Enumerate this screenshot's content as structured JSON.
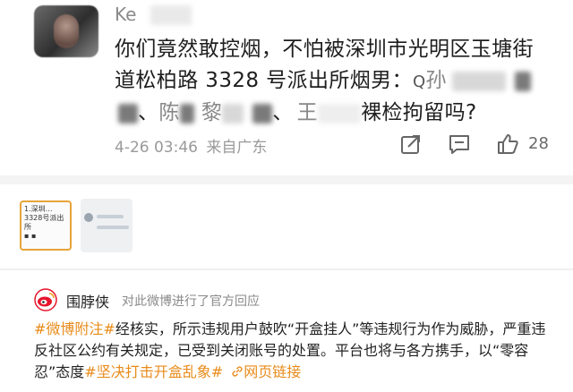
{
  "comment": {
    "username_visible": "Ke",
    "text_line1": "你们竟然敢控烟，不怕被深圳市光明区玉塘街",
    "text_line2": "道松柏路 3328 号派出所烟男：",
    "search_glyph": "Q",
    "name_fragment_1": "孙",
    "name_fragment_2": "、",
    "name_fragment_3": "陈",
    "name_fragment_4": "黎",
    "name_fragment_5": "、",
    "name_fragment_6": "王",
    "text_line3_end": "裸检拘留吗?",
    "timestamp": "4-26 03:46",
    "location": "来自广东",
    "likes": "28"
  },
  "thumbnail": {
    "line1": "1.深圳…",
    "line2": "3328号派出所",
    "line3": "▪ ▪"
  },
  "official": {
    "org_name": "围脖侠",
    "action": "对此微博进行了官方回应",
    "tag1": "#微博附注#",
    "body": "经核实，所示违规用户鼓吹“开盒挂人”等违规行为作为威胁，严重违反社区公约有关规定，已受到关闭账号的处置。平台也将与各方携手，以“零容忍”态度",
    "tag2": "#坚决打击开盒乱象#",
    "link_label": "网页链接"
  },
  "colors": {
    "accent": "#e88b1a",
    "meta": "#9a9a9a"
  }
}
